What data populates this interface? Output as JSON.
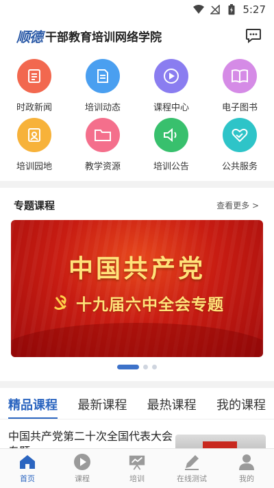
{
  "status_bar": {
    "time": "5:27"
  },
  "header": {
    "logo_text": "顺德",
    "title": "干部教育培训网络学院"
  },
  "grid": [
    {
      "label": "时政新闻",
      "icon": "news-icon",
      "color": "#f2684f"
    },
    {
      "label": "培训动态",
      "icon": "document-icon",
      "color": "#4a9ff0"
    },
    {
      "label": "课程中心",
      "icon": "play-icon",
      "color": "#8a7df0"
    },
    {
      "label": "电子图书",
      "icon": "book-icon",
      "color": "#d58be6"
    },
    {
      "label": "培训园地",
      "icon": "certificate-icon",
      "color": "#f7b23a"
    },
    {
      "label": "教学资源",
      "icon": "folder-icon",
      "color": "#f46f8c"
    },
    {
      "label": "培训公告",
      "icon": "speaker-icon",
      "color": "#38c06d"
    },
    {
      "label": "公共服务",
      "icon": "heart-hands-icon",
      "color": "#2ec4c8"
    }
  ],
  "featured": {
    "title": "专题课程",
    "more": "查看更多 >",
    "banner_title": "中国共产党",
    "banner_subtitle": "十九届六中全会专题"
  },
  "tabs": [
    {
      "label": "精品课程",
      "active": true
    },
    {
      "label": "最新课程",
      "active": false
    },
    {
      "label": "最热课程",
      "active": false
    },
    {
      "label": "我的课程",
      "active": false
    }
  ],
  "course": {
    "title": "中国共产党第二十次全国代表大会专题"
  },
  "bottom_nav": [
    {
      "label": "首页",
      "icon": "home-icon",
      "active": true
    },
    {
      "label": "课程",
      "icon": "play-circle-icon",
      "active": false
    },
    {
      "label": "培训",
      "icon": "training-board-icon",
      "active": false
    },
    {
      "label": "在线测试",
      "icon": "pencil-icon",
      "active": false
    },
    {
      "label": "我的",
      "icon": "person-icon",
      "active": false
    }
  ],
  "colors": {
    "accent": "#2b65c0",
    "banner_red": "#c81c12",
    "banner_gold": "#ffe27a"
  }
}
